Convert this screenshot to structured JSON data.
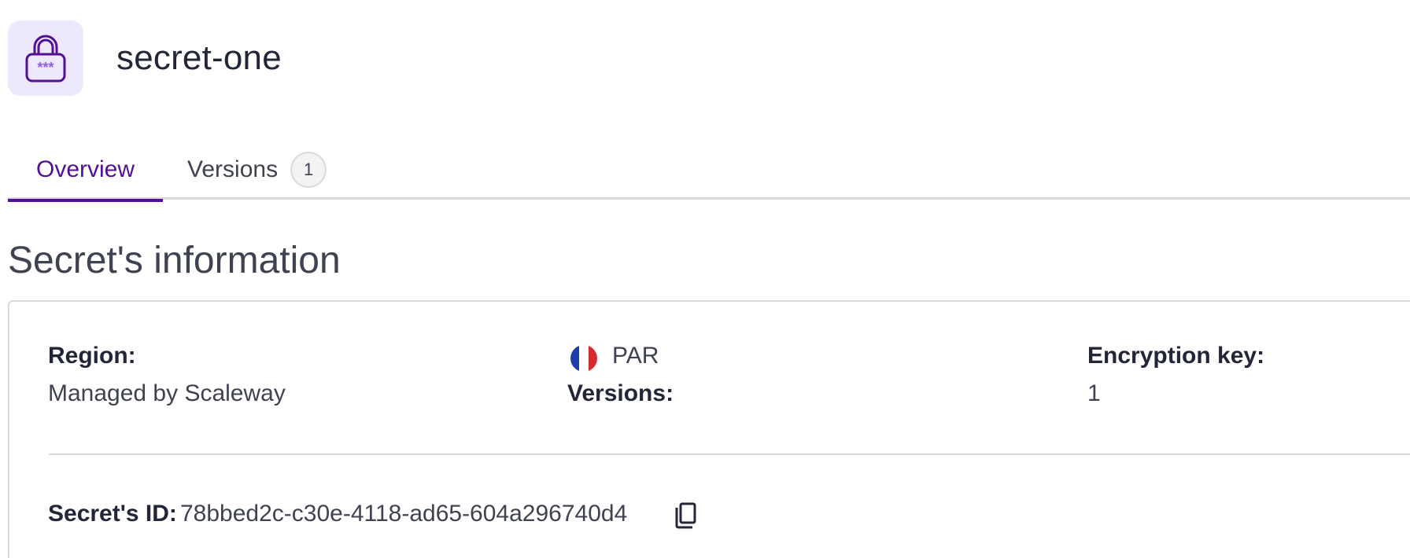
{
  "header": {
    "title": "secret-one",
    "icon": "lock-icon",
    "icon_bg": "#ede8fb",
    "icon_color": "#521094"
  },
  "tabs": [
    {
      "label": "Overview",
      "active": true
    },
    {
      "label": "Versions",
      "count": "1",
      "active": false
    }
  ],
  "section": {
    "title": "Secret's information"
  },
  "info": {
    "region_label": "Region:",
    "region_value": "PAR",
    "region_flag": "fr-flag-icon",
    "encryption_label": "Encryption key:",
    "encryption_value": "Managed by Scaleway",
    "versions_label": "Versions:",
    "versions_value": "1",
    "secret_id_label": "Secret's ID:",
    "secret_id_value": "78bbed2c-c30e-4118-ad65-604a296740d4",
    "copy_icon": "copy-icon"
  },
  "colors": {
    "accent": "#521094",
    "text": "#222638",
    "muted": "#3f4250",
    "border": "#d9dadf"
  }
}
